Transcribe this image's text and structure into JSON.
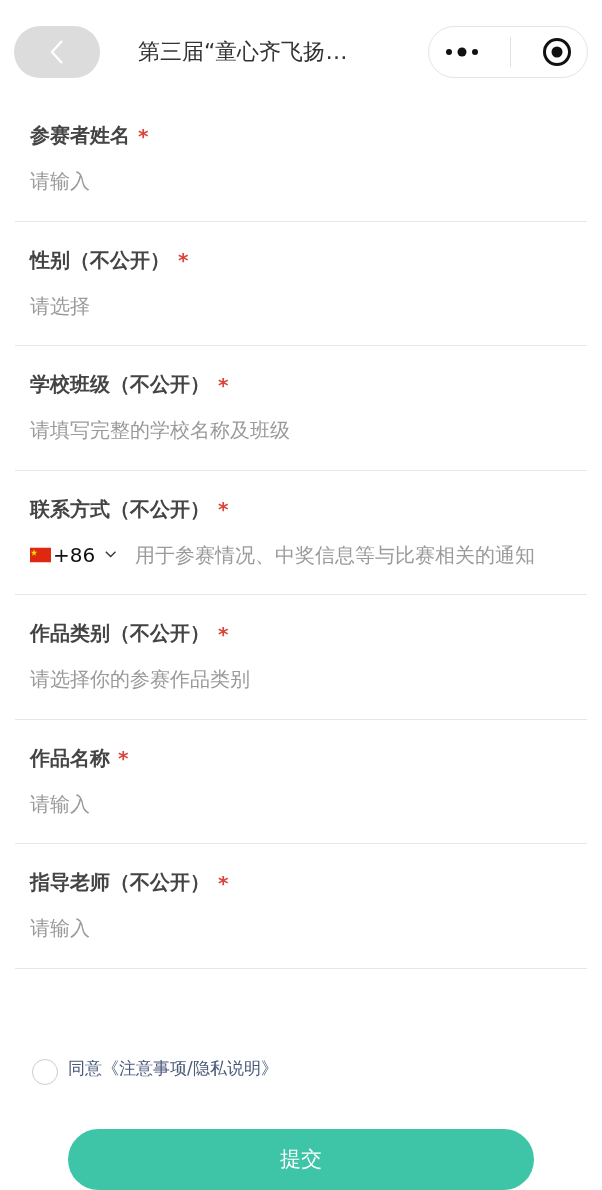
{
  "nav": {
    "title": "第三届“童心齐飞扬…"
  },
  "fields": [
    {
      "kind": "text",
      "label": "参赛者姓名",
      "mark": "*",
      "placeholder": "请输入"
    },
    {
      "kind": "select",
      "label": "性别（不公开）",
      "mark": "*",
      "placeholder": "请选择"
    },
    {
      "kind": "text",
      "label": "学校班级（不公开）",
      "mark": "*",
      "placeholder": "请填写完整的学校名称及班级"
    },
    {
      "kind": "phone",
      "label": "联系方式（不公开）",
      "mark": "*",
      "code": "+86",
      "placeholder": "用于参赛情况、中奖信息等与比赛相关的通知"
    },
    {
      "kind": "select",
      "label": "作品类别（不公开）",
      "mark": "*",
      "placeholder": "请选择你的参赛作品类别"
    },
    {
      "kind": "text",
      "label": "作品名称",
      "mark": "*",
      "placeholder": "请输入"
    },
    {
      "kind": "text",
      "label": "指导老师（不公开）",
      "mark": "*",
      "placeholder": "请输入"
    }
  ],
  "agreement": {
    "checked": false,
    "text": "同意《注意事项/隐私说明》"
  },
  "submit": "提交"
}
